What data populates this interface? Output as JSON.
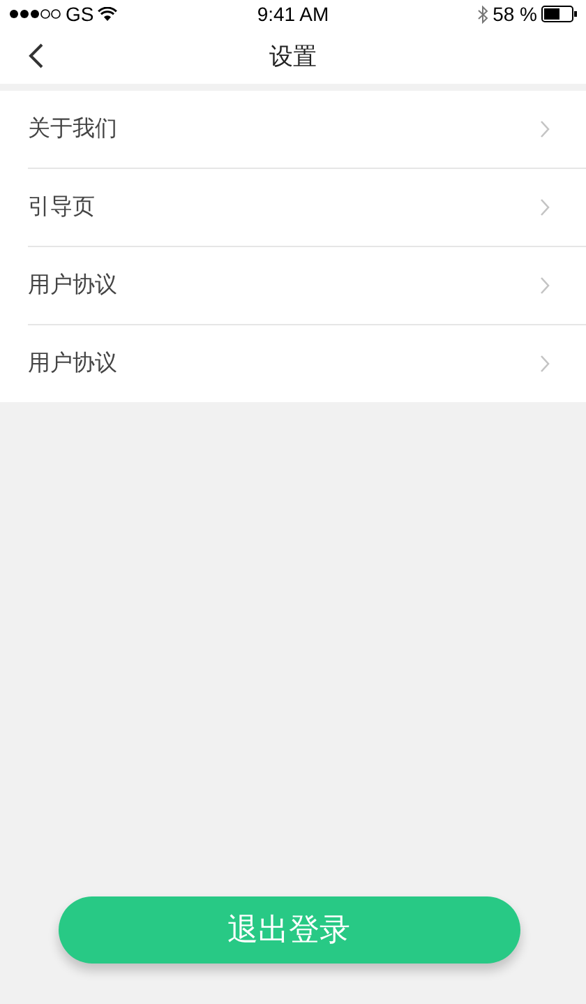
{
  "status_bar": {
    "carrier": "GS",
    "time": "9:41 AM",
    "battery": "58 %"
  },
  "nav": {
    "title": "设置"
  },
  "items": [
    {
      "label": "关于我们"
    },
    {
      "label": "引导页"
    },
    {
      "label": "用户协议"
    },
    {
      "label": "用户协议"
    }
  ],
  "logout_button": "退出登录"
}
